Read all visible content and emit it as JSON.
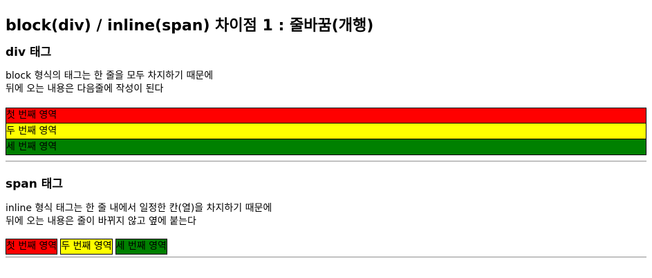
{
  "heading": "block(div) / inline(span) 차이점 1 : 줄바꿈(개행)",
  "div_section": {
    "title": "div 태그",
    "description_lines": [
      "block 형식의 태그는 한 줄을 모두 차지하기 때문에",
      "뒤에 오는 내용은 다음줄에 작성이 된다"
    ],
    "boxes": [
      {
        "label": "첫 번째 영역",
        "color": "#ff0000"
      },
      {
        "label": "두 번째 영역",
        "color": "#ffff00"
      },
      {
        "label": "세 번째 영역",
        "color": "#008000"
      }
    ]
  },
  "span_section": {
    "title": "span 태그",
    "description_lines": [
      "inline 형식 태그는 한 줄 내에서 일정한 칸(열)을 차지하기 때문에",
      "뒤에 오는 내용은 줄이 바뀌지 않고 옆에 붙는다"
    ],
    "boxes": [
      {
        "label": "첫 번째 영역",
        "color": "#ff0000"
      },
      {
        "label": "두 번째 영역",
        "color": "#ffff00"
      },
      {
        "label": "세 번째 영역",
        "color": "#008000"
      }
    ]
  }
}
